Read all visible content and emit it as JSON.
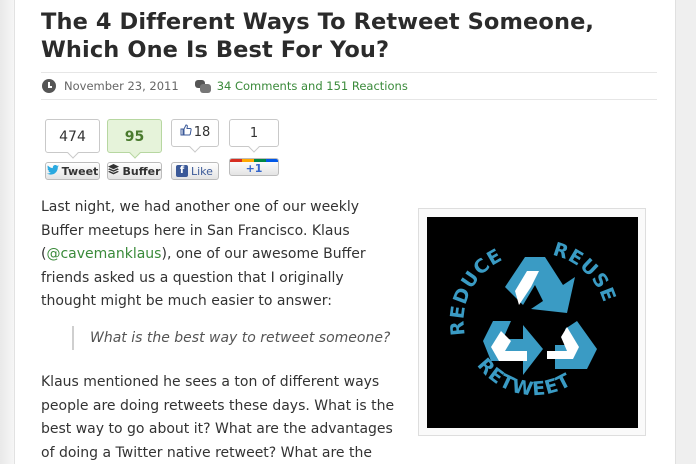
{
  "post": {
    "title": "The 4 Different Ways To Retweet Someone, Which One Is Best For You?",
    "date": "November 23, 2011",
    "comments": "34 Comments and 151 Reactions"
  },
  "share": {
    "tweet_count": "474",
    "tweet_label": "Tweet",
    "buffer_count": "95",
    "buffer_label": "Buffer",
    "like_count": "18",
    "like_label": "Like",
    "plusone_count": "1",
    "plusone_label": "+1"
  },
  "content": {
    "p1_before": "Last night, we had another one of our weekly Buffer meetups here in San Francisco. Klaus (",
    "p1_link": "@cavemanklaus",
    "p1_after": "), one of our awesome Buffer friends asked us a question that I originally thought might be much easier to answer:",
    "quote": "What is the best way to retweet someone?",
    "p2": "Klaus mentioned he sees a ton of different ways people are doing retweets these days. What is the best way to go about it? What are the advantages of doing a Twitter native retweet? What are the"
  },
  "image": {
    "word_left": "REDUCE",
    "word_right": "REUSE",
    "word_bottom": "RETWEET"
  },
  "colors": {
    "accent_green": "#3a8a3a",
    "recycle_blue": "#3a9bc4",
    "facebook_blue": "#3b5998",
    "twitter_blue": "#2aa9e0"
  }
}
